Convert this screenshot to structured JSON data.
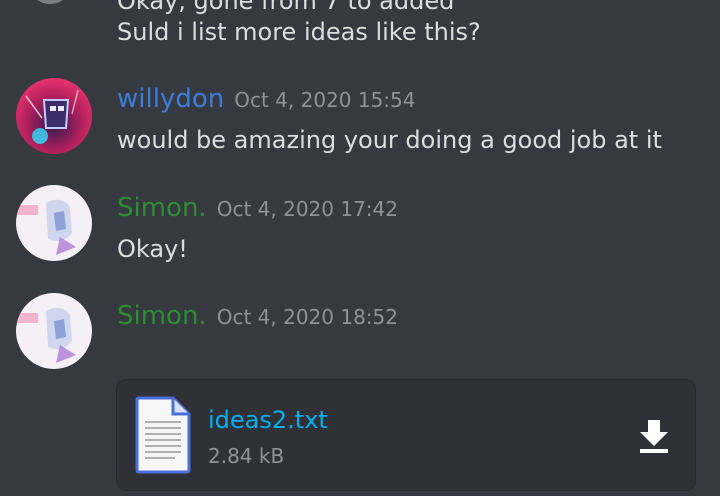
{
  "colors": {
    "background": "#36393f",
    "willydon": "#3f7bd9",
    "simon": "#2e8b35",
    "link": "#00aff4"
  },
  "previous_message": {
    "text_partial": "Okay, gone from 7 to added",
    "text": "Suld i list more ideas like this?"
  },
  "messages": [
    {
      "author": "willydon",
      "timestamp": "Oct 4, 2020 15:54",
      "text": "would be amazing your doing a good job at it"
    },
    {
      "author": "Simon.",
      "timestamp": "Oct 4, 2020 17:42",
      "text": "Okay!"
    },
    {
      "author": "Simon.",
      "timestamp": "Oct 4, 2020 18:52",
      "attachment": {
        "file_name": "ideas2.txt",
        "file_size": "2.84 kB",
        "icon": "text-file-icon",
        "action_icon": "download-icon"
      }
    }
  ]
}
